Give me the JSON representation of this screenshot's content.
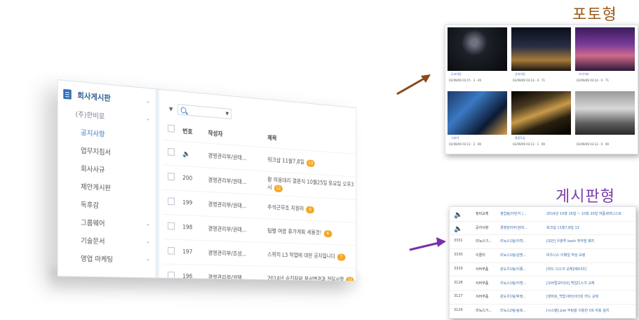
{
  "board": {
    "sidebar": {
      "title": "회사게시판",
      "group": "(주)한비로",
      "items": [
        "공지사항",
        "업무지침서",
        "회사사규",
        "제안게시판",
        "독후감",
        "그룹웨어",
        "기술문서",
        "영업 마케팅"
      ]
    },
    "table": {
      "headers": {
        "num": "번호",
        "author": "작성자",
        "title": "제목"
      },
      "rows": [
        {
          "num": "",
          "author": "경영관리부/권태...",
          "title": "워크샵 11월7,8일",
          "badge": "13"
        },
        {
          "num": "200",
          "author": "경영관리부/권태...",
          "title": "황 의웅대리 결혼식 10월25일 토요일 오후3시",
          "badge": "12"
        },
        {
          "num": "199",
          "author": "경영관리부/권태...",
          "title": "추석근무조 지원자",
          "badge": "8"
        },
        {
          "num": "198",
          "author": "경영관리부/권태...",
          "title": "팀별 여름 휴가계획 세울것!",
          "badge": "6"
        },
        {
          "num": "197",
          "author": "경영관리부/조성...",
          "title": "스위치 L3 작업에 대한 공지입니다",
          "badge": "7"
        },
        {
          "num": "196",
          "author": "경영관리부/권택...",
          "title": "2014년 승진자와 부서변경과 전달사항",
          "badge": "15"
        }
      ]
    }
  },
  "photo_view": {
    "title": "포토형",
    "colors": {
      "accent": "#9a5a1c"
    },
    "items": [
      {
        "caption": "도쿄야경",
        "meta": "02/09/09 03:15 · 3 · 40"
      },
      {
        "caption": "공지야경",
        "meta": "02/09/09 03:14 · 0 · 71"
      },
      {
        "caption": "오다이바",
        "meta": "02/09/09 03:14 · 0 · 71"
      },
      {
        "caption": "시부야",
        "meta": "02/09/09 03:12 · 2 · 90"
      },
      {
        "caption": "홍콩도심",
        "meta": "02/09/09 03:12 · 1 · 90"
      },
      {
        "caption": "",
        "meta": "02/09/09 03:12 · 0 · 90"
      }
    ]
  },
  "list_view": {
    "title": "게시판형",
    "colors": {
      "accent": "#7a3ca8"
    },
    "rows": [
      {
        "num": "",
        "cat": "정비교체",
        "author": "영업팀/이민석 (...",
        "title": "2014년 10월 16일 ~ 10월 20일 여름세미나스트"
      },
      {
        "num": "",
        "cat": "공지사항",
        "author": "경영관리부/권태...",
        "title": "워크샵 11월7,8일 13"
      },
      {
        "num": "3331",
        "cat": "리눅스기...",
        "author": "리눅스1팀/이혁...",
        "title": "[보안] 우분투 bash 취약점 패치"
      },
      {
        "num": "3330",
        "cat": "이클리",
        "author": "리눅스1팀/김명...",
        "title": "비즈니스 이메일 작성 요령"
      },
      {
        "num": "3329",
        "cat": "서버부품",
        "author": "윈도우1팀/이종...",
        "title": "[하드 디스크 교체]에트리디"
      },
      {
        "num": "3128",
        "cat": "서버부품",
        "author": "리눅스1팀/이명...",
        "title": "[오버랍모터10] 백업디스크 교체"
      },
      {
        "num": "3127",
        "cat": "서버부품",
        "author": "윈도우1팀/박정...",
        "title": "[판버모_백업서버]이더넷 카드 교체"
      },
      {
        "num": "3126",
        "cat": "리눅스기...",
        "author": "리눅스2팀/송호...",
        "title": "[시스템] pxe 부팅을 이용한 OS 자동 설치"
      }
    ]
  }
}
